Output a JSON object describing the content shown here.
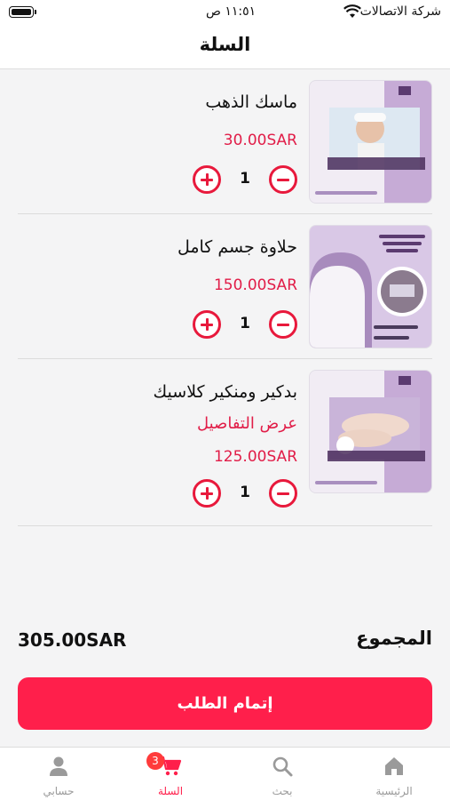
{
  "status_bar": {
    "carrier": "شركة الاتصالات",
    "time": "١١:٥١ ص"
  },
  "navbar": {
    "title": "السلة"
  },
  "cart": {
    "items": [
      {
        "name": "ماسك الذهب",
        "price": "30.00SAR",
        "quantity": "1"
      },
      {
        "name": "حلاوة جسم كامل",
        "price": "150.00SAR",
        "quantity": "1"
      },
      {
        "name": "بدكير ومنكير كلاسيك",
        "details_link": "عرض التفاصيل",
        "price": "125.00SAR",
        "quantity": "1"
      }
    ]
  },
  "summary": {
    "total_label": "المجموع",
    "total_value": "305.00SAR"
  },
  "checkout_button": "إتمام الطلب",
  "tabbar": {
    "tabs": [
      {
        "label": "الرئيسية",
        "icon": "home-icon"
      },
      {
        "label": "بحث",
        "icon": "search-icon"
      },
      {
        "label": "السلة",
        "icon": "cart-icon",
        "badge": "3",
        "active": true
      },
      {
        "label": "حسابي",
        "icon": "user-icon"
      }
    ]
  },
  "colors": {
    "accent": "#ff1f4b",
    "stepper": "#e8193c",
    "badge": "#ff3b3b",
    "inactive": "#9a9a9a"
  }
}
